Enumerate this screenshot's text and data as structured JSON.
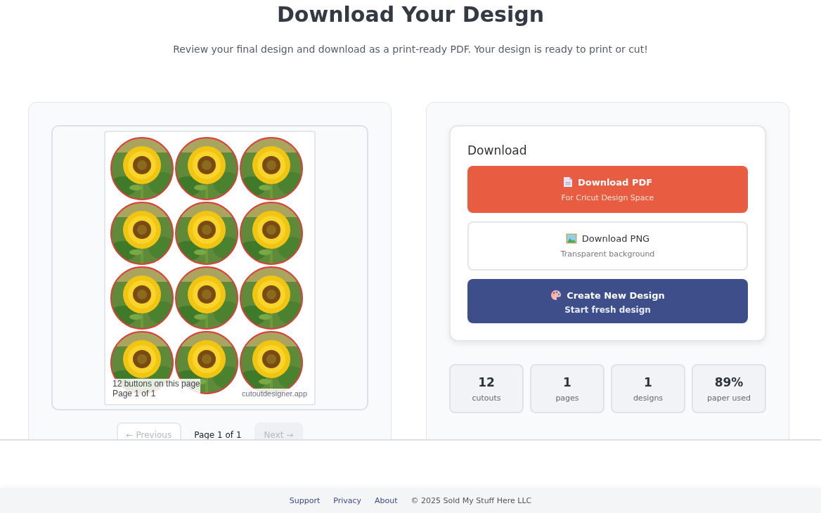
{
  "header": {
    "title": "Download Your Design",
    "subtitle": "Review your final design and download as a print-ready PDF. Your design is ready to print or cut!"
  },
  "preview": {
    "sheet_caption": "12 buttons on this page",
    "sheet_page": "Page 1 of 1",
    "watermark": "cutoutdesigner.app",
    "pagination": {
      "previous": {
        "label": "← Previous",
        "disabled": true
      },
      "page": "Page 1 of 1",
      "next": {
        "label": "Next →",
        "disabled": true
      }
    }
  },
  "download": {
    "title": "Download",
    "buttons": [
      {
        "kind": "pdf",
        "label": "Download PDF",
        "sub": "For Cricut Design Space"
      },
      {
        "kind": "png",
        "label": "Download PNG",
        "sub": "Transparent background"
      },
      {
        "kind": "new",
        "label": "Create New Design",
        "sub": "Start fresh design"
      }
    ]
  },
  "stats": [
    {
      "value": "12",
      "label": "cutouts"
    },
    {
      "value": "1",
      "label": "pages"
    },
    {
      "value": "1",
      "label": "designs"
    },
    {
      "value": "89%",
      "label": "paper used"
    }
  ],
  "footer": {
    "links": [
      "Support",
      "Privacy",
      "About"
    ],
    "copyright": "© 2025 Sold My Stuff Here LLC"
  }
}
